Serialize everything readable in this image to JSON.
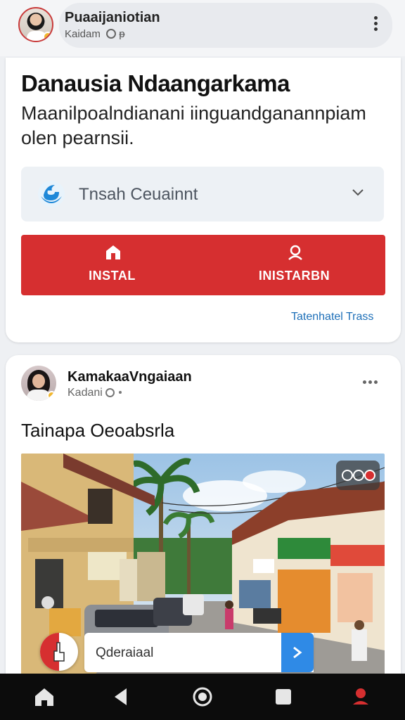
{
  "header": {
    "name": "Puaaijaniotian",
    "subtitle": "Kaidam",
    "subtitle_suffix": "ᵽ"
  },
  "card1": {
    "title": "Danausia Ndaangarkama",
    "description": "Maanilpoalndianani iinguandganannpiam olen pearnsii.",
    "select": {
      "value": "Tnsah Ceuainnt",
      "icon": "globe-logo-icon"
    },
    "buttons": [
      {
        "label": "INSTAL",
        "icon": "home-icon"
      },
      {
        "label": "INISTARBN",
        "icon": "user-icon"
      }
    ],
    "link": "Tatenhatel Trass",
    "accent_color": "#d62f30"
  },
  "post": {
    "author": "KamakaaVngaiaan",
    "meta": "Kadani",
    "caption": "Tainapa Oeoabsrla",
    "photo_description_icon": "street-market-photo",
    "comment_placeholder": "Qderaiaal",
    "send_color": "#2f8ae6"
  },
  "navbar": {
    "items": [
      "home-icon",
      "back-icon",
      "home-circle-icon",
      "recents-icon",
      "user-pin-icon"
    ]
  }
}
